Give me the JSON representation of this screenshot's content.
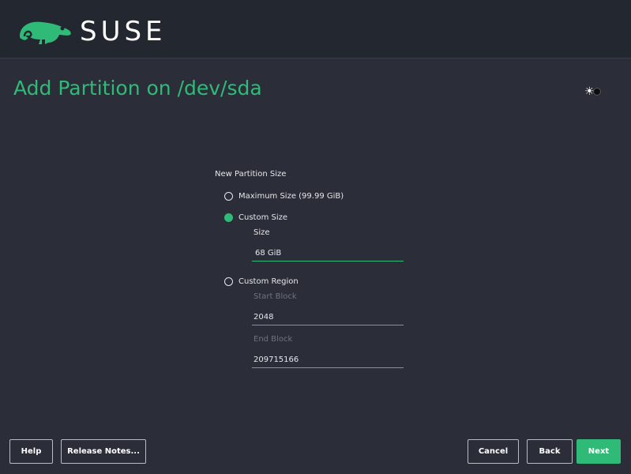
{
  "header": {
    "brand": "SUSE",
    "logo_icon": "chameleon-logo-icon"
  },
  "page": {
    "title": "Add Partition on /dev/sda",
    "theme_icon": "sun-icon"
  },
  "partition_size": {
    "group_label": "New Partition Size",
    "options": [
      {
        "label": "Maximum Size (99.99 GiB)",
        "checked": false
      },
      {
        "label": "Custom Size",
        "checked": true
      },
      {
        "label": "Custom Region",
        "checked": false
      }
    ],
    "size": {
      "label": "Size",
      "value": "68 GiB"
    },
    "start_block": {
      "label": "Start Block",
      "value": "2048"
    },
    "end_block": {
      "label": "End Block",
      "value": "209715166"
    }
  },
  "buttons": {
    "help": "Help",
    "release_notes": "Release Notes...",
    "cancel": "Cancel",
    "back": "Back",
    "next": "Next"
  },
  "colors": {
    "accent": "#30ba78",
    "background": "#2b2e39",
    "header": "#232730"
  }
}
